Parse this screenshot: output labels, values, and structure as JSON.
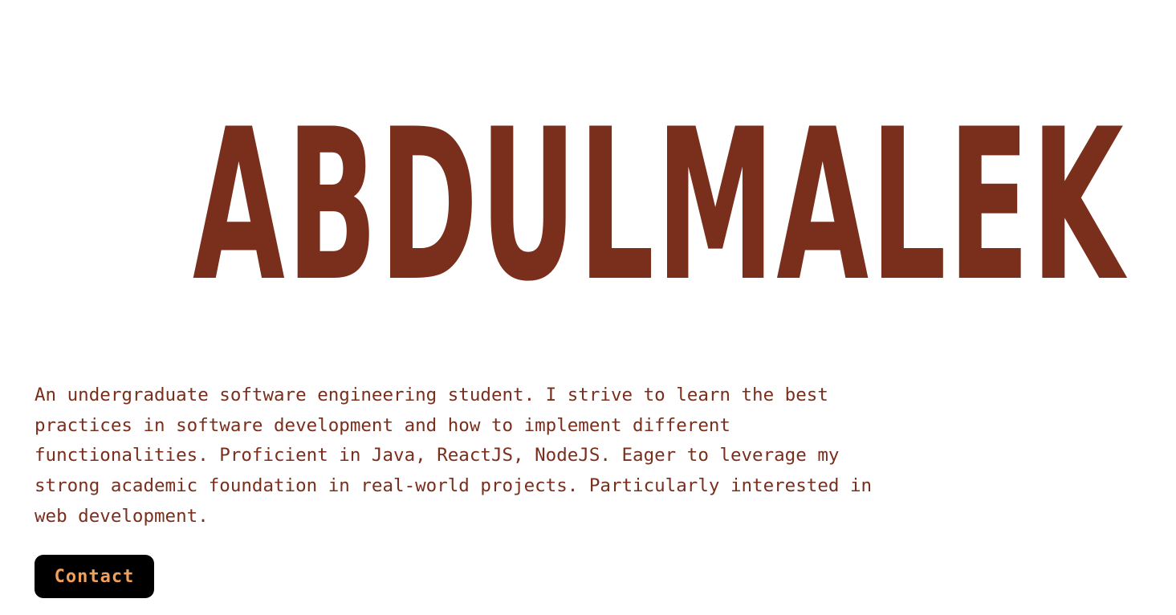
{
  "hero": {
    "name": "ABDULMALEK",
    "color": "#7a2e1c"
  },
  "bio": {
    "text": "An undergraduate software engineering student. I strive to learn the best practices in software development and how to implement different functionalities. Proficient in Java, ReactJS, NodeJS. Eager to leverage my strong academic foundation in real-world projects. Particularly interested in web development."
  },
  "contact_button": {
    "label": "Contact",
    "background": "#000000",
    "text_color": "#f0a05a"
  }
}
